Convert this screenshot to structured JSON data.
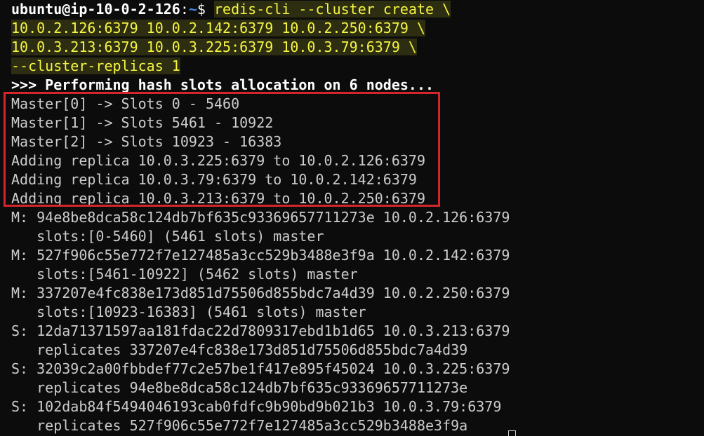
{
  "prompt": {
    "user_host": "ubuntu@ip-10-0-2-126",
    "colon": ":",
    "path": "~",
    "symbol": "$ "
  },
  "command": {
    "line1": "redis-cli --cluster create \\",
    "line2": "10.0.2.126:6379 10.0.2.142:6379 10.0.2.250:6379 \\",
    "line3": "10.0.3.213:6379 10.0.3.225:6379 10.0.3.79:6379 \\",
    "line4": "--cluster-replicas 1"
  },
  "output": {
    "header": ">>> Performing hash slots allocation on 6 nodes...",
    "allocation": [
      "Master[0] -> Slots 0 - 5460",
      "Master[1] -> Slots 5461 - 10922",
      "Master[2] -> Slots 10923 - 16383",
      "Adding replica 10.0.3.225:6379 to 10.0.2.126:6379",
      "Adding replica 10.0.3.79:6379 to 10.0.2.142:6379",
      "Adding replica 10.0.3.213:6379 to 10.0.2.250:6379"
    ],
    "nodes": [
      "M: 94e8be8dca58c124db7bf635c93369657711273e 10.0.2.126:6379",
      "   slots:[0-5460] (5461 slots) master",
      "M: 527f906c55e772f7e127485a3cc529b3488e3f9a 10.0.2.142:6379",
      "   slots:[5461-10922] (5462 slots) master",
      "M: 337207e4fc838e173d851d75506d855bdc7a4d39 10.0.2.250:6379",
      "   slots:[10923-16383] (5461 slots) master",
      "S: 12da71371597aa181fdac22d7809317ebd1b1d65 10.0.3.213:6379",
      "   replicates 337207e4fc838e173d851d75506d855bdc7a4d39",
      "S: 32039c2a00fbbdef77c2e57be1f417e895f45024 10.0.3.225:6379",
      "   replicates 94e8be8dca58c124db7bf635c93369657711273e",
      "S: 102dab84f5494046193cab0fdfc9b90bd9b021b3 10.0.3.79:6379",
      "   replicates 527f906c55e772f7e127485a3cc529b3488e3f9a"
    ]
  },
  "colors": {
    "background": "#0c0c0c",
    "text": "#cccccc",
    "highlight_text": "#f5f543",
    "highlight_bg": "#2d2d12",
    "path": "#3b8eea",
    "annotation_box": "#d3262c"
  }
}
